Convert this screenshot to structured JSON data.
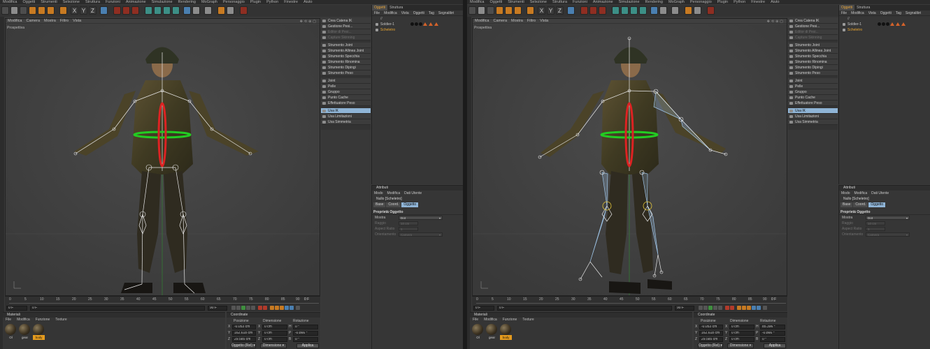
{
  "menu": [
    "Modifica",
    "Oggetti",
    "Strumenti",
    "Selezione",
    "Struttura",
    "Funzioni",
    "Animazione",
    "Simulazione",
    "Rendering",
    "MoGraph",
    "Personaggio",
    "Plugin",
    "Python",
    "Finestre",
    "Aiuto"
  ],
  "viewport": {
    "menu": [
      "Modifica",
      "Camera",
      "Mostra",
      "Filtro",
      "Vista"
    ],
    "label": "Prospettiva"
  },
  "timeline": {
    "ticks": [
      "0",
      "5",
      "10",
      "15",
      "20",
      "25",
      "30",
      "35",
      "40",
      "45",
      "50",
      "55",
      "60",
      "65",
      "70",
      "75",
      "80",
      "85",
      "90"
    ],
    "end_frame": "0 F",
    "start_field": "0 F",
    "current_field": "0 F",
    "range_end": "90 F",
    "max_field": "90 F"
  },
  "materials": {
    "title": "Materiali",
    "menu": [
      "File",
      "Modifica",
      "Funzione",
      "Texture"
    ],
    "items": [
      {
        "label": "Ol",
        "selected": false
      },
      {
        "label": "gear",
        "selected": false
      },
      {
        "label": "body",
        "selected": true
      }
    ]
  },
  "coordinates": {
    "title": "Coordinate",
    "headers": {
      "position": "Posizione",
      "size": "Dimensione",
      "rotation": "Rotazione"
    },
    "rows": [
      {
        "axis": "X",
        "pos": "-0.053 cm",
        "size_axis": "X",
        "size": "0 cm",
        "rot_axis": "H",
        "rot": "0 °"
      },
      {
        "axis": "Y",
        "pos": "162.618 cm",
        "size_axis": "Y",
        "size": "0 cm",
        "rot_axis": "P",
        "rot": "-0.866 °"
      },
      {
        "axis": "Z",
        "pos": "29.585 cm",
        "size_axis": "Z",
        "size": "0 cm",
        "rot_axis": "B",
        "rot": "0 °"
      }
    ],
    "rows_right": [
      {
        "axis": "X",
        "pos": "-0.053 cm",
        "size_axis": "X",
        "size": "0 cm",
        "rot_axis": "H",
        "rot": "85.396 °"
      },
      {
        "axis": "Y",
        "pos": "162.618 cm",
        "size_axis": "Y",
        "size": "0 cm",
        "rot_axis": "P",
        "rot": "-0.866 °"
      },
      {
        "axis": "Z",
        "pos": "29.585 cm",
        "size_axis": "Z",
        "size": "0 cm",
        "rot_axis": "B",
        "rot": "0 °"
      }
    ],
    "mode_dropdown": "Oggetto (Rel) ▾",
    "size_dropdown": "Dimensione ▾",
    "apply": "Applica"
  },
  "commands": [
    {
      "label": "Crea Catena IK",
      "state": "normal"
    },
    {
      "label": "Gestione Pesi...",
      "state": "normal"
    },
    {
      "label": "Editor di Pesi...",
      "state": "dim"
    },
    {
      "label": "Capture Skinning",
      "state": "dim"
    },
    {
      "label": "Strumento Joint",
      "state": "normal",
      "gap": true
    },
    {
      "label": "Strumento Allinea Joint",
      "state": "normal"
    },
    {
      "label": "Strumento Specchia",
      "state": "normal"
    },
    {
      "label": "Strumento Rinomina",
      "state": "normal"
    },
    {
      "label": "Strumento Dipingi",
      "state": "normal"
    },
    {
      "label": "Strumento Peso",
      "state": "normal"
    },
    {
      "label": "Joint",
      "state": "normal",
      "gap": true
    },
    {
      "label": "Pelle",
      "state": "normal"
    },
    {
      "label": "Gruppo",
      "state": "normal"
    },
    {
      "label": "Punto Cache",
      "state": "normal"
    },
    {
      "label": "Effettuatore Peso",
      "state": "normal"
    },
    {
      "label": "Usa IK",
      "state": "sel",
      "gap": true
    },
    {
      "label": "Usa Limitazioni",
      "state": "normal"
    },
    {
      "label": "Usa Simmetria",
      "state": "normal"
    }
  ],
  "object_manager": {
    "tabs": [
      "Oggetti",
      "Struttura"
    ],
    "menu": [
      "File",
      "Modifica",
      "Vista",
      "Oggetti",
      "Tag",
      "Segnalibri"
    ],
    "path": "//",
    "objects": [
      {
        "name": "Soldier-1",
        "highlight": false
      },
      {
        "name": "Scheletro",
        "highlight": true
      }
    ]
  },
  "attributes": {
    "title": "Attributi",
    "menu": [
      "Modo",
      "Modifica",
      "Dati Utente"
    ],
    "object": "Nullo [Scheletro]",
    "tabs": [
      "Base",
      "Coord.",
      "Oggetto"
    ],
    "section": "Proprietà Oggetto",
    "props": [
      {
        "label": "Mostra",
        "value": "Dot",
        "dim": false,
        "short": false
      },
      {
        "label": "Raggio",
        "value": "10 cm",
        "dim": true,
        "short": true
      },
      {
        "label": "Aspect Ratio",
        "value": "1",
        "dim": true,
        "short": true
      },
      {
        "label": "Orientamento",
        "value": "Camera",
        "dim": true,
        "short": false
      }
    ]
  },
  "colors": {
    "accent_orange": "#e7a53a",
    "selection_blue": "#8fb4d6",
    "ik_green": "#22cc22",
    "ik_red": "#dd2222",
    "bone_blue": "#9ec4e6"
  }
}
